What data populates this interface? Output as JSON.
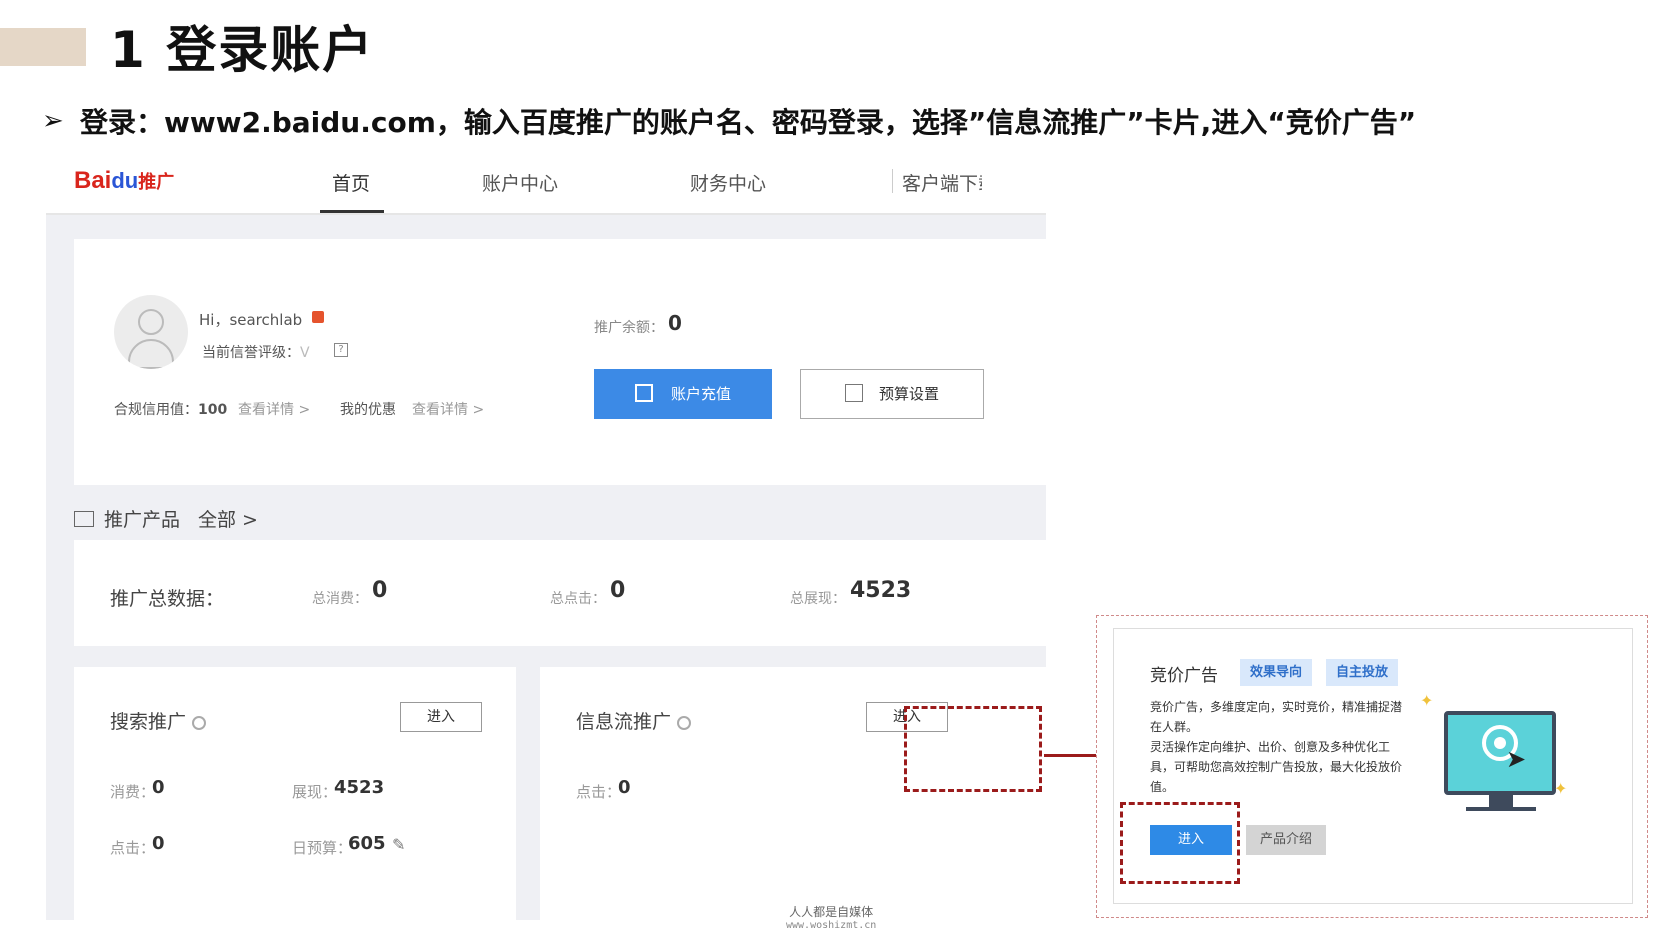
{
  "slide": {
    "title": "1 登录账户",
    "bullet_symbol": "➢",
    "bullet_text": "登录：www2.baidu.com，输入百度推广的账户名、密码登录，选择”信息流推广”卡片,进入“竞价广告”"
  },
  "portal": {
    "logo": {
      "bai": "Bai",
      "paw": "du",
      "tuiguang": "推广"
    },
    "nav": [
      "首页",
      "账户中心",
      "财务中心",
      "客户端下载"
    ],
    "account": {
      "greeting": "Hi，searchlab",
      "credit_rating_label": "当前信誉评级：",
      "credit_rating_value": "V",
      "help_icon": "?",
      "compliance_label": "合规信用值：",
      "compliance_value": "100",
      "view_detail_1": "查看详情 >",
      "my_offers": "我的优惠",
      "view_detail_2": "查看详情 >",
      "balance_label": "推广余额：",
      "balance_value": "0",
      "recharge_button": "账户充值",
      "budget_button": "预算设置"
    },
    "products": {
      "label": "推广产品",
      "all_link": "全部 >"
    },
    "totals": {
      "label": "推广总数据：",
      "spend_label": "总消费：",
      "spend_value": "0",
      "clicks_label": "总点击：",
      "clicks_value": "0",
      "impressions_label": "总展现：",
      "impressions_value": "4523"
    },
    "search_card": {
      "title": "搜索推广",
      "enter_button": "进入",
      "spend_label": "消费：",
      "spend_value": "0",
      "impressions_label": "展现：",
      "impressions_value": "4523",
      "clicks_label": "点击：",
      "clicks_value": "0",
      "daily_budget_label": "日预算：",
      "daily_budget_value": "605"
    },
    "feed_card": {
      "title": "信息流推广",
      "enter_button": "进入",
      "clicks_label": "点击：",
      "clicks_value": "0"
    }
  },
  "zoom": {
    "title": "竞价广告",
    "tag_1": "效果导向",
    "tag_2": "自主投放",
    "description_1": "竞价广告，多维度定向，实时竞价，精准捕捉潜在人群。",
    "description_2": "灵活操作定向维护、出价、创意及多种优化工具，可帮助您高效控制广告投放，最大化投放价值。",
    "enter_button": "进入",
    "intro_button": "产品介绍"
  },
  "watermark": {
    "line_1": "人人都是自媒体",
    "line_2": "www.woshizmt.cn"
  },
  "colors": {
    "accent_blue": "#3c8ae6",
    "highlight_red": "#9b1b1b",
    "title_bar": "#e5d7c7"
  }
}
